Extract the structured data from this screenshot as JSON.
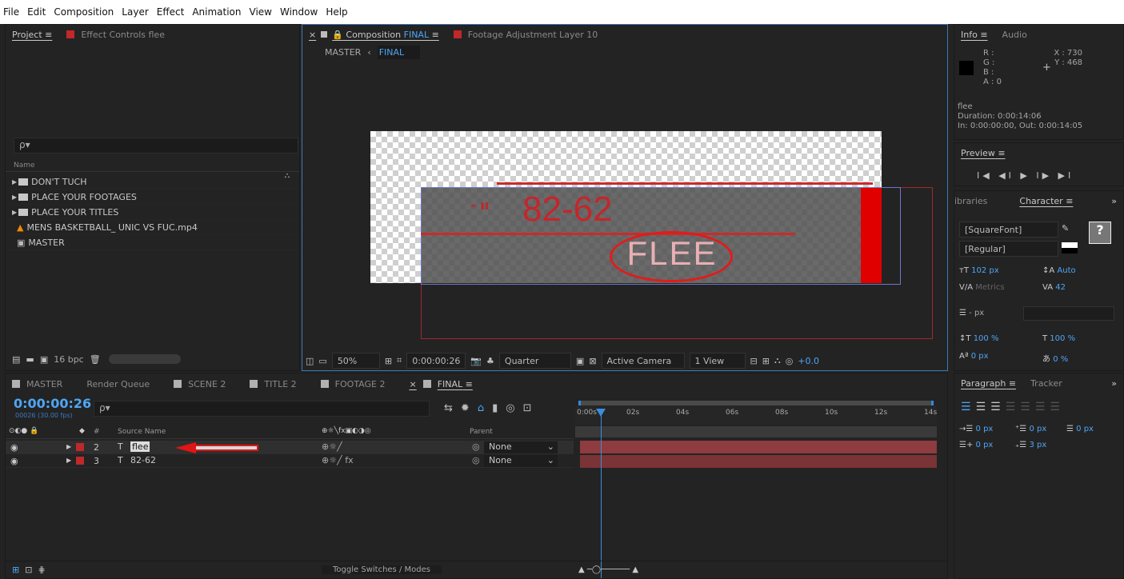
{
  "menu": [
    "File",
    "Edit",
    "Composition",
    "Layer",
    "Effect",
    "Animation",
    "View",
    "Window",
    "Help"
  ],
  "project": {
    "tab_project": "Project",
    "tab_effect_controls": "Effect Controls flee",
    "search_placeholder": "ρ▾",
    "col_name": "Name",
    "items": [
      {
        "label": "DON'T TUCH",
        "kind": "folder"
      },
      {
        "label": "PLACE YOUR FOOTAGES",
        "kind": "folder"
      },
      {
        "label": "PLACE YOUR TITLES",
        "kind": "folder"
      },
      {
        "label": "MENS BASKETBALL_ UNIC VS FUC.mp4",
        "kind": "vlc"
      },
      {
        "label": "MASTER",
        "kind": "comp"
      }
    ],
    "bpc": "16 bpc"
  },
  "comp": {
    "tab_comp_prefix": "Composition",
    "tab_comp_name": "FINAL",
    "tab_footage": "Footage Adjustment Layer 10",
    "crumb_master": "MASTER",
    "crumb_final": "FINAL",
    "overlay_score": "82-62",
    "overlay_title": "FLEE",
    "overlay_dash": "- ıı",
    "zoom": "50%",
    "timecode": "0:00:00:26",
    "resolution": "Quarter",
    "camera": "Active Camera",
    "views": "1 View",
    "exposure": "+0.0"
  },
  "info": {
    "tab_info": "Info",
    "tab_audio": "Audio",
    "r": "R :",
    "g": "G :",
    "b": "B :",
    "a": "A : 0",
    "x": "X : 730",
    "y": "Y : 468",
    "layer_name": "flee",
    "duration": "Duration: 0:00:14:06",
    "inout": "In: 0:00:00:00, Out: 0:00:14:05"
  },
  "preview": {
    "tab": "Preview",
    "controls": "I◀ ◀I ▶ I▶ ▶I"
  },
  "character": {
    "tab_libraries": "ibraries",
    "tab_character": "Character",
    "font": "[SquareFont]",
    "style": "[Regular]",
    "size": "102 px",
    "leading": "Auto",
    "kerning": "Metrics",
    "tracking": "42",
    "stroke": "- px",
    "vscale": "100 %",
    "hscale": "100 %",
    "baseline": "0 px",
    "tsume": "0 %"
  },
  "paragraph": {
    "tab_paragraph": "Paragraph",
    "tab_tracker": "Tracker",
    "indent_left": "0 px",
    "space_before": "0 px",
    "indent_right": "0 px",
    "first_line": "0 px",
    "space_after": "3 px"
  },
  "timeline": {
    "tabs": [
      {
        "label": "MASTER",
        "color": "#b1b1b1"
      },
      {
        "label": "Render Queue",
        "color": ""
      },
      {
        "label": "SCENE 2",
        "color": "#b1b1b1"
      },
      {
        "label": "TITLE 2",
        "color": "#b1b1b1"
      },
      {
        "label": "FOOTAGE 2",
        "color": "#b1b1b1"
      },
      {
        "label": "FINAL",
        "color": "#b1b1b1"
      }
    ],
    "timecode": "0:00:00:26",
    "frames": "00026 (30.00 fps)",
    "col_hash": "#",
    "col_source": "Source Name",
    "col_parent": "Parent",
    "layers": [
      {
        "num": "2",
        "name": "flee",
        "parent": "None"
      },
      {
        "num": "3",
        "name": "82-62",
        "parent": "None"
      }
    ],
    "ruler": [
      "0:00s",
      "02s",
      "04s",
      "06s",
      "08s",
      "10s",
      "12s",
      "14s"
    ],
    "toggle": "Toggle Switches / Modes",
    "colors": {
      "accent": "#4ea6f5",
      "bar": "#8e3c3f",
      "label": "#c0282c",
      "arrow": "#e01515"
    }
  }
}
